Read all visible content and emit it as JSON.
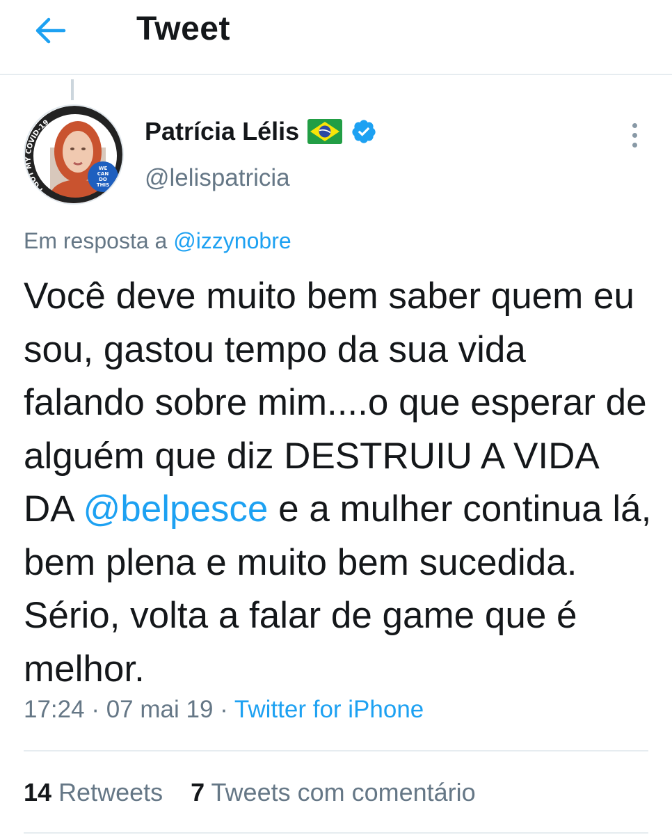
{
  "header": {
    "title": "Tweet"
  },
  "author": {
    "name": "Patrícia Lélis",
    "flag": "🇧🇷",
    "handle": "@lelispatricia",
    "avatar_text": "I GOT MY COVID-19 VACCINE",
    "avatar_badge_lines": [
      "WE",
      "CAN",
      "DO",
      "THIS"
    ]
  },
  "tweet": {
    "reply_prefix": "Em resposta a",
    "reply_handle": "@izzynobre",
    "text_before_mention": "Você deve muito bem saber quem eu sou, gastou tempo da sua vida falando sobre mim....o que esperar de alguém que diz DESTRUIU A VIDA DA ",
    "mention": "@belpesce",
    "text_after_mention": " e a mulher continua lá, bem plena e muito bem sucedida. Sério, volta a falar de game que é melhor.",
    "time": "17:24",
    "date": "07 mai 19",
    "separator": "·",
    "source": "Twitter for iPhone"
  },
  "stats": {
    "retweets_count": "14",
    "retweets_label": "Retweets",
    "quotes_count": "7",
    "quotes_label": "Tweets com comentário"
  },
  "colors": {
    "accent": "#1da1f2",
    "text": "#14171a",
    "secondary": "#657786",
    "divider": "#e6ecf0"
  }
}
